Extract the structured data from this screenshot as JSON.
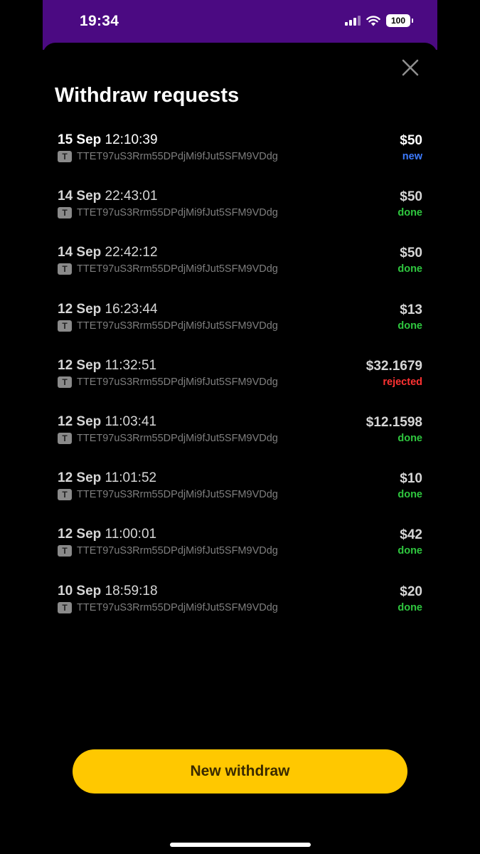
{
  "status_bar": {
    "time": "19:34",
    "battery": "100"
  },
  "sheet": {
    "title": "Withdraw requests"
  },
  "colors": {
    "new": "#3d7bff",
    "done": "#2fc73f",
    "rejected": "#ff3232",
    "button": "#ffc800",
    "header": "#4b0a82"
  },
  "requests": [
    {
      "day": "15 Sep",
      "time": "12:10:39",
      "address": "TTET97uS3Rrm55DPdjMi9fJut5SFM9VDdg",
      "amount": "$50",
      "status": "new"
    },
    {
      "day": "14 Sep",
      "time": "22:43:01",
      "address": "TTET97uS3Rrm55DPdjMi9fJut5SFM9VDdg",
      "amount": "$50",
      "status": "done"
    },
    {
      "day": "14 Sep",
      "time": "22:42:12",
      "address": "TTET97uS3Rrm55DPdjMi9fJut5SFM9VDdg",
      "amount": "$50",
      "status": "done"
    },
    {
      "day": "12 Sep",
      "time": "16:23:44",
      "address": "TTET97uS3Rrm55DPdjMi9fJut5SFM9VDdg",
      "amount": "$13",
      "status": "done"
    },
    {
      "day": "12 Sep",
      "time": "11:32:51",
      "address": "TTET97uS3Rrm55DPdjMi9fJut5SFM9VDdg",
      "amount": "$32.1679",
      "status": "rejected"
    },
    {
      "day": "12 Sep",
      "time": "11:03:41",
      "address": "TTET97uS3Rrm55DPdjMi9fJut5SFM9VDdg",
      "amount": "$12.1598",
      "status": "done"
    },
    {
      "day": "12 Sep",
      "time": "11:01:52",
      "address": "TTET97uS3Rrm55DPdjMi9fJut5SFM9VDdg",
      "amount": "$10",
      "status": "done"
    },
    {
      "day": "12 Sep",
      "time": "11:00:01",
      "address": "TTET97uS3Rrm55DPdjMi9fJut5SFM9VDdg",
      "amount": "$42",
      "status": "done"
    },
    {
      "day": "10 Sep",
      "time": "18:59:18",
      "address": "TTET97uS3Rrm55DPdjMi9fJut5SFM9VDdg",
      "amount": "$20",
      "status": "done"
    }
  ],
  "address_icon_letter": "T",
  "primary_button": {
    "label": "New withdraw"
  }
}
